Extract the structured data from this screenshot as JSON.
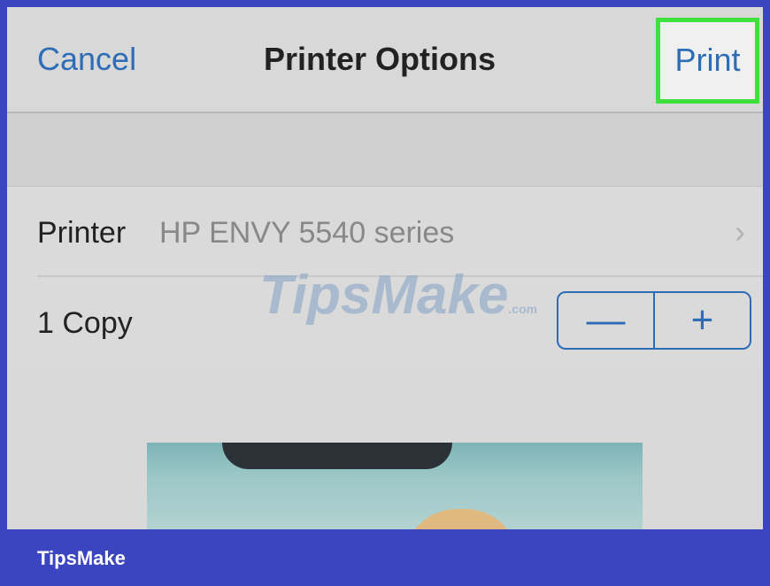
{
  "nav": {
    "cancel_label": "Cancel",
    "title": "Printer Options",
    "print_label": "Print"
  },
  "printer_row": {
    "label": "Printer",
    "value": "HP ENVY 5540 series",
    "chevron": "›",
    "chevron_icon": "chevron-right-icon"
  },
  "copies_row": {
    "label": "1 Copy",
    "minus": "—",
    "plus": "+"
  },
  "watermark": {
    "text": "TipsMake",
    "suffix": ".com"
  },
  "footer": {
    "brand": "TipsMake"
  },
  "colors": {
    "link_blue": "#2d6cb7",
    "highlight_green": "#3fe13f",
    "frame_blue": "#3b45c0"
  }
}
